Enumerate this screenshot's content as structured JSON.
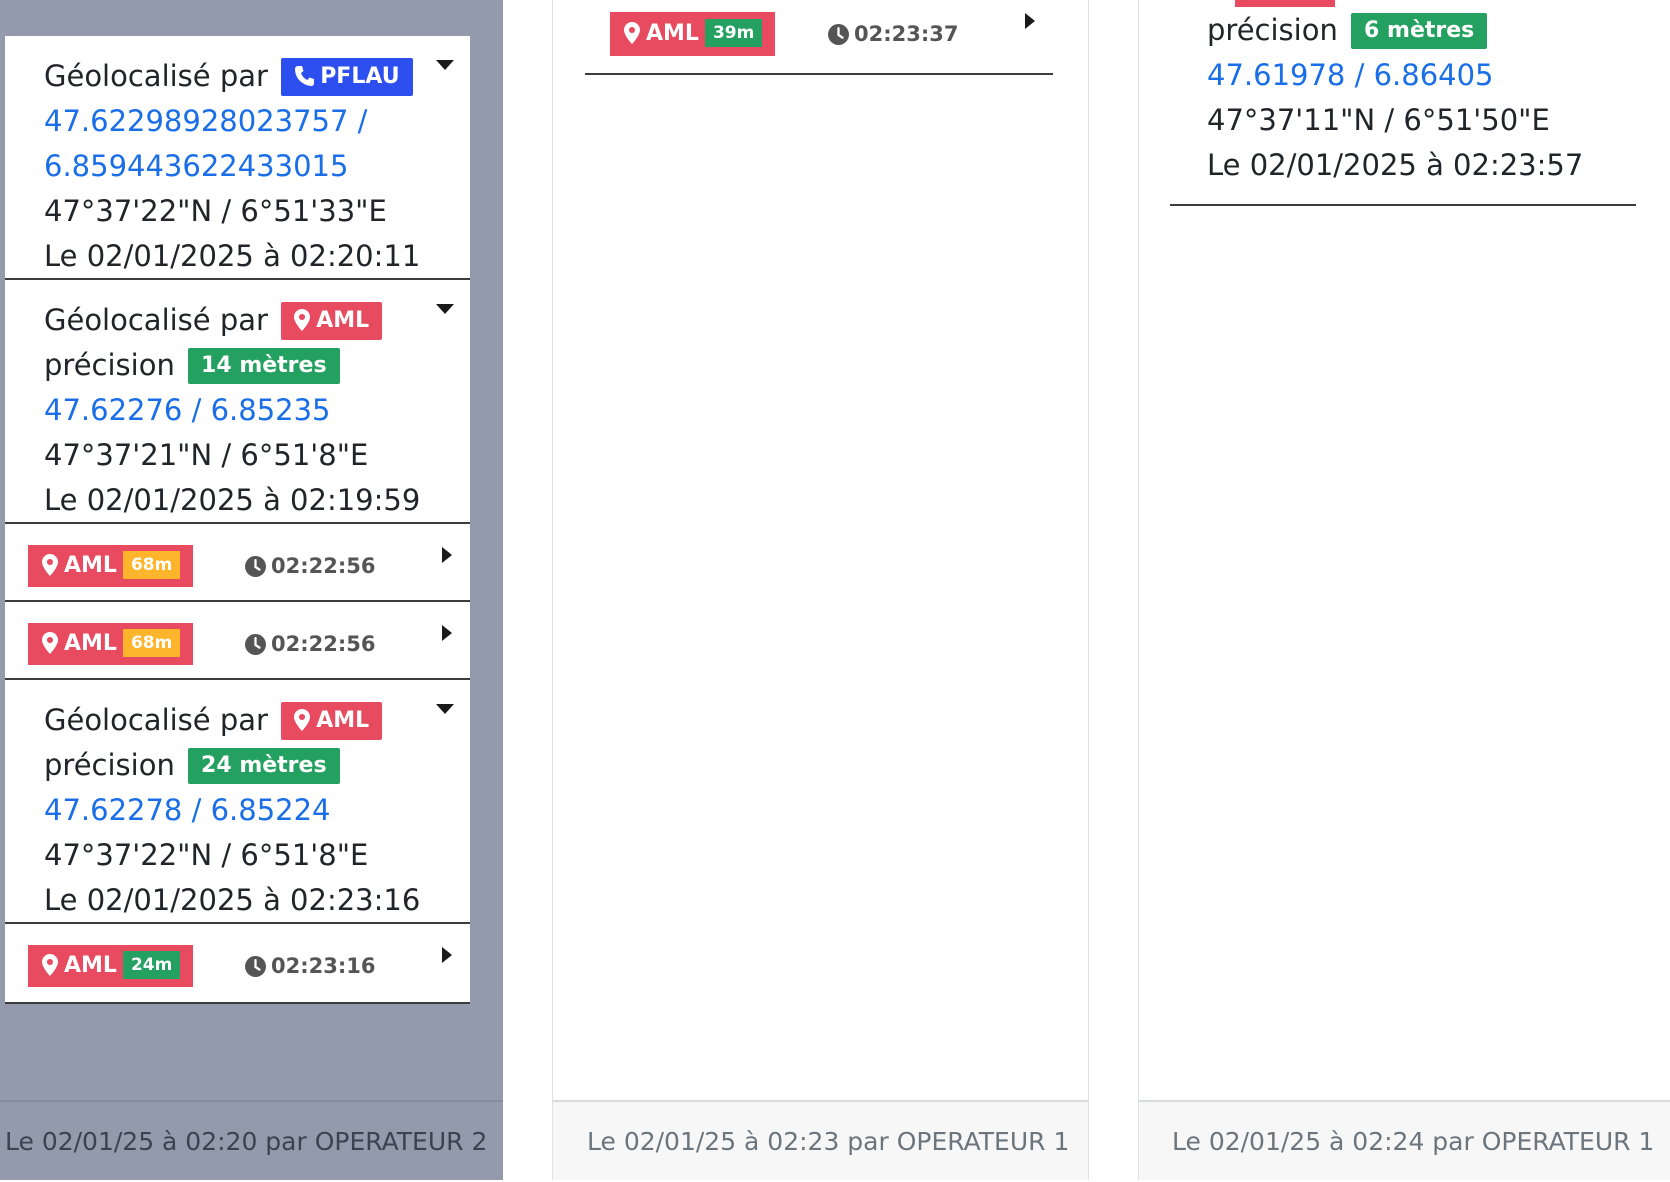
{
  "colors": {
    "pflau_badge": "#2e4ff0",
    "aml_badge": "#e84a5f",
    "precision_good": "#24a161",
    "precision_medium": "#ffb52b",
    "coordinate_link": "#1a6fe8",
    "panel_gray": "#939aab"
  },
  "panel1": {
    "entries": [
      {
        "label": "Géolocalisé par",
        "source": "PFLAU",
        "source_icon": "phone-icon",
        "coords_line1": "47.62298928023757 /",
        "coords_line2": "6.859443622433015",
        "dms": "47°37'22\"N / 6°51'33\"E",
        "date": "Le 02/01/2025 à 02:20:11"
      },
      {
        "label": "Géolocalisé par",
        "source": "AML",
        "source_icon": "map-pin-icon",
        "precision_label": "précision",
        "precision": "14 mètres",
        "coords": "47.62276 / 6.85235",
        "dms": "47°37'21\"N / 6°51'8\"E",
        "date": "Le 02/01/2025 à 02:19:59"
      },
      {
        "source": "AML",
        "precision": "68m",
        "precision_level": "medium",
        "time": "02:22:56"
      },
      {
        "source": "AML",
        "precision": "68m",
        "precision_level": "medium",
        "time": "02:22:56"
      },
      {
        "label": "Géolocalisé par",
        "source": "AML",
        "source_icon": "map-pin-icon",
        "precision_label": "précision",
        "precision": "24 mètres",
        "coords": "47.62278 / 6.85224",
        "dms": "47°37'22\"N / 6°51'8\"E",
        "date": "Le 02/01/2025 à 02:23:16"
      },
      {
        "source": "AML",
        "precision": "24m",
        "precision_level": "good",
        "time": "02:23:16"
      }
    ],
    "footer": "Le 02/01/25 à 02:20 par OPERATEUR 2"
  },
  "panel2": {
    "entries": [
      {
        "source": "AML",
        "precision": "39m",
        "precision_level": "good",
        "time": "02:23:37"
      }
    ],
    "footer": "Le 02/01/25 à 02:23 par OPERATEUR 1"
  },
  "panel3": {
    "entry": {
      "precision_label": "précision",
      "precision": "6 mètres",
      "coords": "47.61978 / 6.86405",
      "dms": "47°37'11\"N / 6°51'50\"E",
      "date": "Le 02/01/2025 à 02:23:57"
    },
    "footer": "Le 02/01/25 à 02:24 par OPERATEUR 1"
  }
}
